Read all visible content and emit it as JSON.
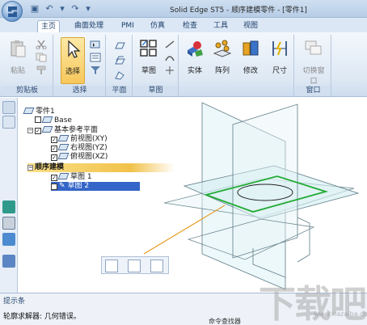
{
  "window": {
    "title": "Solid Edge ST5 - 顺序建模零件 - [零件1]"
  },
  "ribbon": {
    "tabs": [
      "主页",
      "曲面处理",
      "PMI",
      "仿真",
      "检查",
      "工具",
      "视图"
    ],
    "active_tab": "主页",
    "groups": {
      "clipboard": {
        "label": "剪贴板",
        "paste": "粘贴"
      },
      "select": {
        "label": "选择",
        "select": "选择"
      },
      "plane": {
        "label": "平面"
      },
      "sketch": {
        "label": "草图",
        "sketch": "草图"
      },
      "solid": {
        "solid": "实体",
        "pattern": "阵列",
        "modify": "修改",
        "dimension": "尺寸"
      },
      "window": {
        "label": "窗口",
        "switch_window": "切换窗口"
      }
    }
  },
  "tree": {
    "root": "零件1",
    "base": "Base",
    "ref_planes": "基本参考平面",
    "planes": [
      "前视图(XY)",
      "右视图(YZ)",
      "俯视图(XZ)"
    ],
    "sequential": "顺序建模",
    "sketches": [
      "草图 1",
      "草图 2"
    ]
  },
  "prompt": {
    "title": "提示条",
    "message": "轮廓求解器: 几何错误。",
    "extra": "命令查找器"
  },
  "watermark": {
    "text": "下载吧",
    "sub": "www.xiazaiba.com"
  },
  "colors": {
    "ribbon_bg": "#dde8f4",
    "selection": "#f7c75b",
    "plane_fill": "#cfeaf0",
    "sketch_green": "#22aa33"
  }
}
